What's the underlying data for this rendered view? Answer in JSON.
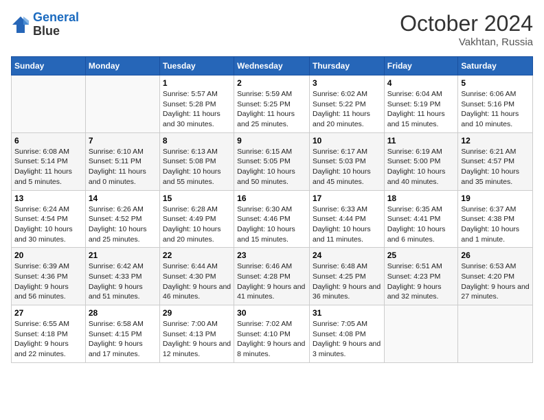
{
  "header": {
    "logo_line1": "General",
    "logo_line2": "Blue",
    "month": "October 2024",
    "location": "Vakhtan, Russia"
  },
  "days_of_week": [
    "Sunday",
    "Monday",
    "Tuesday",
    "Wednesday",
    "Thursday",
    "Friday",
    "Saturday"
  ],
  "weeks": [
    [
      {
        "day": "",
        "sunrise": "",
        "sunset": "",
        "daylight": ""
      },
      {
        "day": "",
        "sunrise": "",
        "sunset": "",
        "daylight": ""
      },
      {
        "day": "1",
        "sunrise": "Sunrise: 5:57 AM",
        "sunset": "Sunset: 5:28 PM",
        "daylight": "Daylight: 11 hours and 30 minutes."
      },
      {
        "day": "2",
        "sunrise": "Sunrise: 5:59 AM",
        "sunset": "Sunset: 5:25 PM",
        "daylight": "Daylight: 11 hours and 25 minutes."
      },
      {
        "day": "3",
        "sunrise": "Sunrise: 6:02 AM",
        "sunset": "Sunset: 5:22 PM",
        "daylight": "Daylight: 11 hours and 20 minutes."
      },
      {
        "day": "4",
        "sunrise": "Sunrise: 6:04 AM",
        "sunset": "Sunset: 5:19 PM",
        "daylight": "Daylight: 11 hours and 15 minutes."
      },
      {
        "day": "5",
        "sunrise": "Sunrise: 6:06 AM",
        "sunset": "Sunset: 5:16 PM",
        "daylight": "Daylight: 11 hours and 10 minutes."
      }
    ],
    [
      {
        "day": "6",
        "sunrise": "Sunrise: 6:08 AM",
        "sunset": "Sunset: 5:14 PM",
        "daylight": "Daylight: 11 hours and 5 minutes."
      },
      {
        "day": "7",
        "sunrise": "Sunrise: 6:10 AM",
        "sunset": "Sunset: 5:11 PM",
        "daylight": "Daylight: 11 hours and 0 minutes."
      },
      {
        "day": "8",
        "sunrise": "Sunrise: 6:13 AM",
        "sunset": "Sunset: 5:08 PM",
        "daylight": "Daylight: 10 hours and 55 minutes."
      },
      {
        "day": "9",
        "sunrise": "Sunrise: 6:15 AM",
        "sunset": "Sunset: 5:05 PM",
        "daylight": "Daylight: 10 hours and 50 minutes."
      },
      {
        "day": "10",
        "sunrise": "Sunrise: 6:17 AM",
        "sunset": "Sunset: 5:03 PM",
        "daylight": "Daylight: 10 hours and 45 minutes."
      },
      {
        "day": "11",
        "sunrise": "Sunrise: 6:19 AM",
        "sunset": "Sunset: 5:00 PM",
        "daylight": "Daylight: 10 hours and 40 minutes."
      },
      {
        "day": "12",
        "sunrise": "Sunrise: 6:21 AM",
        "sunset": "Sunset: 4:57 PM",
        "daylight": "Daylight: 10 hours and 35 minutes."
      }
    ],
    [
      {
        "day": "13",
        "sunrise": "Sunrise: 6:24 AM",
        "sunset": "Sunset: 4:54 PM",
        "daylight": "Daylight: 10 hours and 30 minutes."
      },
      {
        "day": "14",
        "sunrise": "Sunrise: 6:26 AM",
        "sunset": "Sunset: 4:52 PM",
        "daylight": "Daylight: 10 hours and 25 minutes."
      },
      {
        "day": "15",
        "sunrise": "Sunrise: 6:28 AM",
        "sunset": "Sunset: 4:49 PM",
        "daylight": "Daylight: 10 hours and 20 minutes."
      },
      {
        "day": "16",
        "sunrise": "Sunrise: 6:30 AM",
        "sunset": "Sunset: 4:46 PM",
        "daylight": "Daylight: 10 hours and 15 minutes."
      },
      {
        "day": "17",
        "sunrise": "Sunrise: 6:33 AM",
        "sunset": "Sunset: 4:44 PM",
        "daylight": "Daylight: 10 hours and 11 minutes."
      },
      {
        "day": "18",
        "sunrise": "Sunrise: 6:35 AM",
        "sunset": "Sunset: 4:41 PM",
        "daylight": "Daylight: 10 hours and 6 minutes."
      },
      {
        "day": "19",
        "sunrise": "Sunrise: 6:37 AM",
        "sunset": "Sunset: 4:38 PM",
        "daylight": "Daylight: 10 hours and 1 minute."
      }
    ],
    [
      {
        "day": "20",
        "sunrise": "Sunrise: 6:39 AM",
        "sunset": "Sunset: 4:36 PM",
        "daylight": "Daylight: 9 hours and 56 minutes."
      },
      {
        "day": "21",
        "sunrise": "Sunrise: 6:42 AM",
        "sunset": "Sunset: 4:33 PM",
        "daylight": "Daylight: 9 hours and 51 minutes."
      },
      {
        "day": "22",
        "sunrise": "Sunrise: 6:44 AM",
        "sunset": "Sunset: 4:30 PM",
        "daylight": "Daylight: 9 hours and 46 minutes."
      },
      {
        "day": "23",
        "sunrise": "Sunrise: 6:46 AM",
        "sunset": "Sunset: 4:28 PM",
        "daylight": "Daylight: 9 hours and 41 minutes."
      },
      {
        "day": "24",
        "sunrise": "Sunrise: 6:48 AM",
        "sunset": "Sunset: 4:25 PM",
        "daylight": "Daylight: 9 hours and 36 minutes."
      },
      {
        "day": "25",
        "sunrise": "Sunrise: 6:51 AM",
        "sunset": "Sunset: 4:23 PM",
        "daylight": "Daylight: 9 hours and 32 minutes."
      },
      {
        "day": "26",
        "sunrise": "Sunrise: 6:53 AM",
        "sunset": "Sunset: 4:20 PM",
        "daylight": "Daylight: 9 hours and 27 minutes."
      }
    ],
    [
      {
        "day": "27",
        "sunrise": "Sunrise: 6:55 AM",
        "sunset": "Sunset: 4:18 PM",
        "daylight": "Daylight: 9 hours and 22 minutes."
      },
      {
        "day": "28",
        "sunrise": "Sunrise: 6:58 AM",
        "sunset": "Sunset: 4:15 PM",
        "daylight": "Daylight: 9 hours and 17 minutes."
      },
      {
        "day": "29",
        "sunrise": "Sunrise: 7:00 AM",
        "sunset": "Sunset: 4:13 PM",
        "daylight": "Daylight: 9 hours and 12 minutes."
      },
      {
        "day": "30",
        "sunrise": "Sunrise: 7:02 AM",
        "sunset": "Sunset: 4:10 PM",
        "daylight": "Daylight: 9 hours and 8 minutes."
      },
      {
        "day": "31",
        "sunrise": "Sunrise: 7:05 AM",
        "sunset": "Sunset: 4:08 PM",
        "daylight": "Daylight: 9 hours and 3 minutes."
      },
      {
        "day": "",
        "sunrise": "",
        "sunset": "",
        "daylight": ""
      },
      {
        "day": "",
        "sunrise": "",
        "sunset": "",
        "daylight": ""
      }
    ]
  ]
}
